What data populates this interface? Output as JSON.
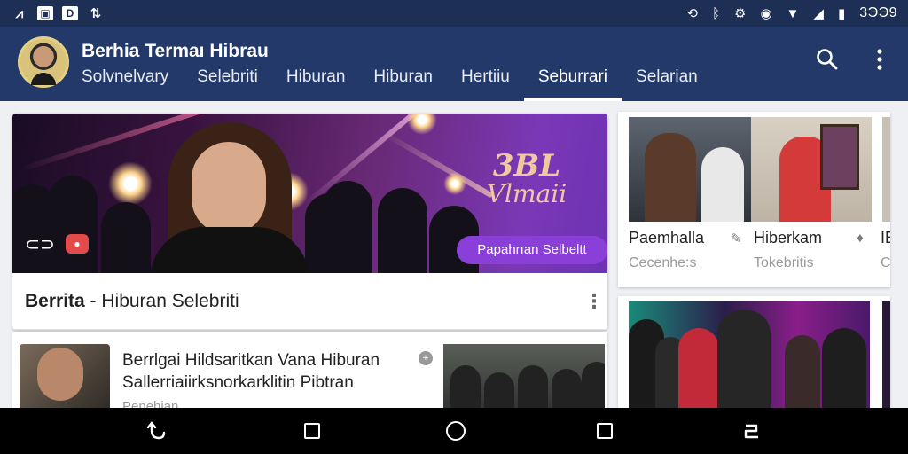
{
  "status_bar": {
    "left_icons": [
      "signal-glyph-icon",
      "image-icon",
      "doc-icon",
      "data-icon"
    ],
    "right_icons": [
      "sync-icon",
      "bluetooth-icon",
      "settings-icon",
      "vibrate-icon",
      "wifi-icon",
      "cell-signal-icon",
      "battery-icon"
    ],
    "time": "3ЭЭ9"
  },
  "app_bar": {
    "title": "Berhia Termaı Hibrau",
    "tabs": [
      "Solvnelvary",
      "Selebriti",
      "Hiburan",
      "Hiburan",
      "Hertiiu",
      "Seburrari",
      "Selarian"
    ],
    "active_tab_index": 5,
    "accent": "#22396a"
  },
  "main_card": {
    "hero_title_line1": "3BL",
    "hero_title_line2": "Vlmaii",
    "hero_badge": "Papahrıan Selbeltt",
    "title_bold": "Berrita",
    "title_rest": " - Hiburan Selebriti"
  },
  "list_item": {
    "headline": "Berrlgai Hildsaritkan Vana Hiburan Sallerriaiirksnorkarklitin Pibtran",
    "sub": "Penehian"
  },
  "side_cards": [
    {
      "label": "Paemhalla",
      "sub": "Cecenhe:s"
    },
    {
      "label": "Hiberkam",
      "sub": "Tokebritis"
    },
    {
      "label": "IBI",
      "sub": "Co"
    }
  ]
}
